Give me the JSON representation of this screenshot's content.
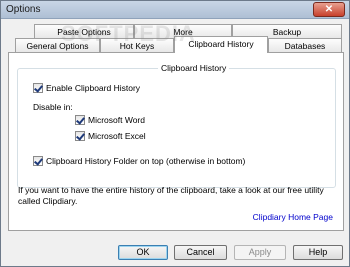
{
  "window": {
    "title": "Options",
    "close_glyph": "✕"
  },
  "tabs_row_back": [
    {
      "label": "Paste Options"
    },
    {
      "label": "More"
    },
    {
      "label": "Backup"
    }
  ],
  "tabs_row_front": [
    {
      "label": "General Options"
    },
    {
      "label": "Hot Keys"
    },
    {
      "label": "Clipboard History"
    },
    {
      "label": "Databases"
    }
  ],
  "active_tab": "Clipboard History",
  "group": {
    "title": "Clipboard History",
    "enable_label": "Enable Clipboard History",
    "disable_in_label": "Disable in:",
    "word_label": "Microsoft Word",
    "excel_label": "Microsoft Excel",
    "folder_top_label": "Clipboard History Folder on top (otherwise in bottom)"
  },
  "checkboxes": {
    "enable": true,
    "word": true,
    "excel": true,
    "folder_top": true
  },
  "note": "If you want to have the entire history of the clipboard, take a look at our free utility called Clipdiary.",
  "link": "Clipdiary Home Page",
  "buttons": {
    "ok": "OK",
    "cancel": "Cancel",
    "apply": "Apply",
    "help": "Help"
  },
  "watermark": "SOFTPEDIA"
}
